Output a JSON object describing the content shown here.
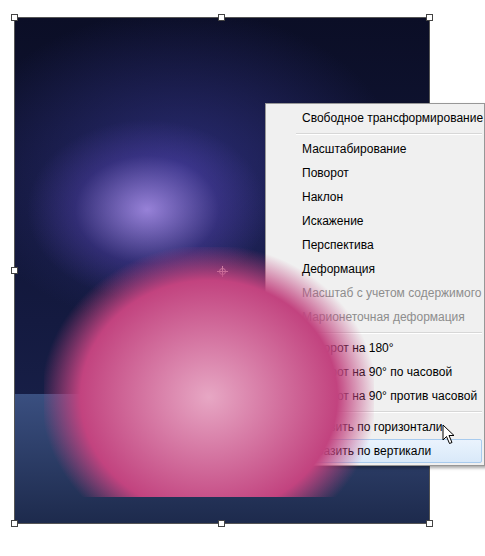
{
  "menu": {
    "sections": [
      {
        "items": [
          {
            "label": "Свободное трансформирование",
            "disabled": false,
            "selected": false
          }
        ]
      },
      {
        "items": [
          {
            "label": "Масштабирование",
            "disabled": false,
            "selected": false
          },
          {
            "label": "Поворот",
            "disabled": false,
            "selected": false
          },
          {
            "label": "Наклон",
            "disabled": false,
            "selected": false
          },
          {
            "label": "Искажение",
            "disabled": false,
            "selected": false
          },
          {
            "label": "Перспектива",
            "disabled": false,
            "selected": false
          },
          {
            "label": "Деформация",
            "disabled": false,
            "selected": false
          },
          {
            "label": "Масштаб с учетом содержимого",
            "disabled": true,
            "selected": false
          },
          {
            "label": "Марионеточная деформация",
            "disabled": true,
            "selected": false
          }
        ]
      },
      {
        "items": [
          {
            "label": "Поворот на 180°",
            "disabled": false,
            "selected": false
          },
          {
            "label": "Поворот на 90° по часовой",
            "disabled": false,
            "selected": false
          },
          {
            "label": "Поворот на 90° против часовой",
            "disabled": false,
            "selected": false
          }
        ]
      },
      {
        "items": [
          {
            "label": "Отразить по горизонтали",
            "disabled": false,
            "selected": false
          },
          {
            "label": "Отразить по вертикали",
            "disabled": false,
            "selected": true
          }
        ]
      }
    ]
  }
}
